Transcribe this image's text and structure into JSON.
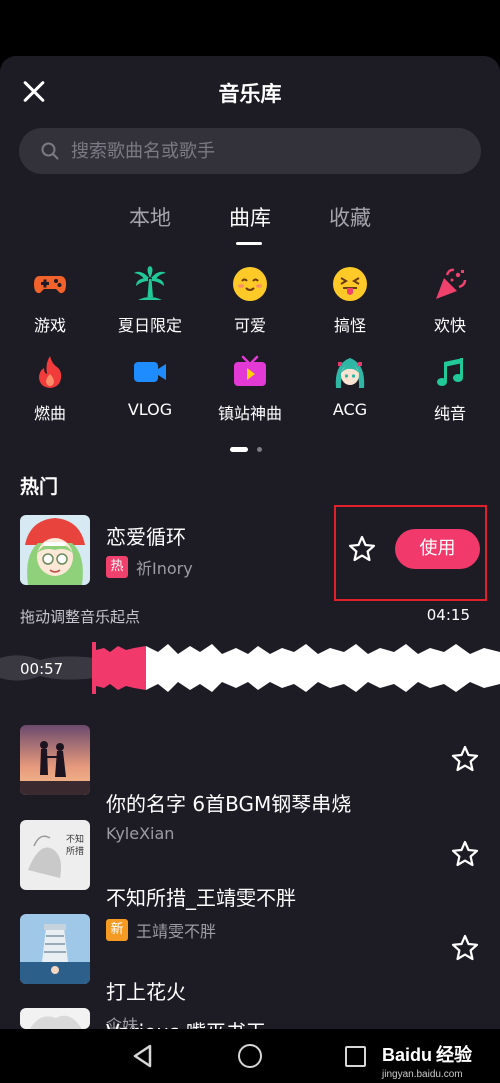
{
  "header": {
    "title": "音乐库"
  },
  "search": {
    "placeholder": "搜索歌曲名或歌手"
  },
  "tabs": [
    {
      "label": "本地"
    },
    {
      "label": "曲库",
      "active": true
    },
    {
      "label": "收藏"
    }
  ],
  "categories": [
    {
      "label": "游戏",
      "icon": "gamepad-icon"
    },
    {
      "label": "夏日限定",
      "icon": "palm-tree-icon"
    },
    {
      "label": "可爱",
      "icon": "smiley-face-icon"
    },
    {
      "label": "搞怪",
      "icon": "tongue-face-icon"
    },
    {
      "label": "欢快",
      "icon": "party-popper-icon"
    },
    {
      "label": "燃曲",
      "icon": "flame-icon"
    },
    {
      "label": "VLOG",
      "icon": "video-camera-icon"
    },
    {
      "label": "镇站神曲",
      "icon": "tv-icon"
    },
    {
      "label": "ACG",
      "icon": "anime-character-icon"
    },
    {
      "label": "纯音",
      "icon": "music-note-icon"
    }
  ],
  "pager": {
    "page": 1,
    "total": 2
  },
  "section": {
    "title": "热门"
  },
  "current_song": {
    "title": "恋爱循环",
    "badge": "热",
    "artist": "祈Inory",
    "use_label": "使用",
    "hint": "拖动调整音乐起点",
    "duration": "04:15",
    "start_time": "00:57"
  },
  "songs": [
    {
      "title": "你的名字 6首BGM钢琴串烧",
      "artist": "KyleXian"
    },
    {
      "title": "不知所措_王靖雯不胖",
      "badge": "新",
      "artist": "王靖雯不胖",
      "cover_text": "不知\n所措"
    },
    {
      "title": "打上花火",
      "artist": "伞妹"
    }
  ],
  "partial_song": {
    "title": "Various 嘴巫书玉"
  },
  "watermark": {
    "text": "Baidu经验",
    "subtext": "jingyan.baidu.com"
  },
  "colors": {
    "accent": "#f1396b",
    "sheet_bg": "#1d1b24",
    "search_bg": "#33323b",
    "highlight": "#e0202b"
  }
}
